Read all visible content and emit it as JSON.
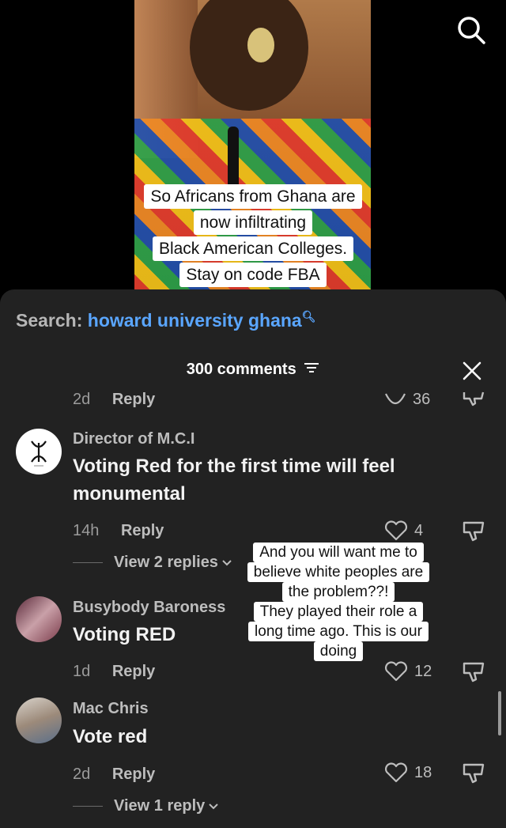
{
  "video": {
    "caption_lines": [
      "So Africans from Ghana are",
      "now infiltrating",
      "Black American Colleges.",
      "Stay on code FBA"
    ]
  },
  "search": {
    "label": "Search:",
    "query": "howard university ghana"
  },
  "comments_header": {
    "count_label": "300 comments"
  },
  "partial_row": {
    "time": "2d",
    "reply_label": "Reply",
    "likes": "36"
  },
  "comments": [
    {
      "username": "Director of M.C.I",
      "text": "Voting Red for the first time will feel monumental",
      "time": "14h",
      "reply_label": "Reply",
      "likes": "4",
      "view_replies": "View 2 replies"
    },
    {
      "username": "Busybody Baroness",
      "text": "Voting RED",
      "time": "1d",
      "reply_label": "Reply",
      "likes": "12"
    },
    {
      "username": "Mac Chris",
      "text": "Vote red",
      "time": "2d",
      "reply_label": "Reply",
      "likes": "18",
      "view_replies": "View 1 reply"
    }
  ],
  "overlay_text": {
    "lines": [
      "And you will want me to",
      "believe white peoples are",
      "the problem??!",
      "They played their role a",
      "long time ago. This is our",
      "doing"
    ]
  },
  "icons": {
    "search": "search-icon",
    "close": "close-icon",
    "filter": "filter-icon",
    "like": "heart-icon",
    "dislike": "thumbs-down-icon",
    "chevron": "chevron-down-icon"
  }
}
